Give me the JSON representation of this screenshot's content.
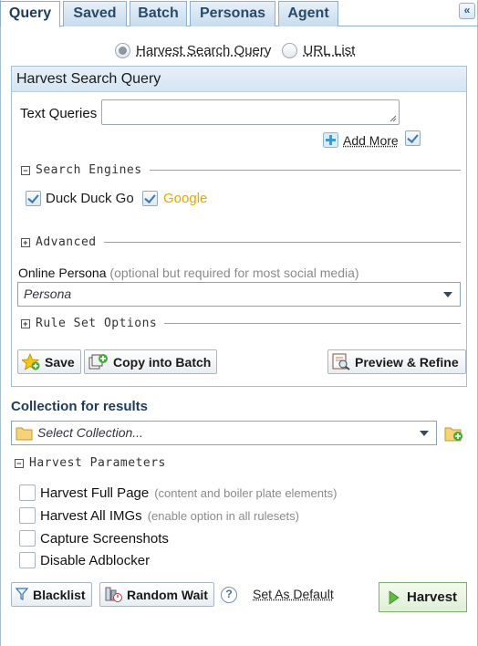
{
  "tabs": [
    {
      "label": "Query",
      "active": true
    },
    {
      "label": "Saved",
      "active": false
    },
    {
      "label": "Batch",
      "active": false
    },
    {
      "label": "Personas",
      "active": false
    },
    {
      "label": "Agent",
      "active": false
    }
  ],
  "collapse_glyph": "«",
  "mode": {
    "options": [
      {
        "label": "Harvest Search Query",
        "selected": true
      },
      {
        "label": "URL List",
        "selected": false
      }
    ]
  },
  "panel": {
    "title": "Harvest Search Query",
    "text_queries_label": "Text Queries",
    "text_queries_value": "",
    "text_queries_checked": true,
    "add_more_label": "Add More",
    "search_engines": {
      "title": "Search Engines",
      "engines": [
        {
          "label": "Duck Duck Go",
          "checked": true,
          "color": "#1a1a1a"
        },
        {
          "label": "Google",
          "checked": true,
          "color": "#e6a700"
        }
      ]
    },
    "advanced_title": "Advanced",
    "persona": {
      "label": "Online Persona",
      "hint": "(optional but required for most social media)",
      "selected": "Persona"
    },
    "rule_set_title": "Rule Set Options",
    "buttons": {
      "save": "Save",
      "copy_batch": "Copy into Batch",
      "preview": "Preview & Refine"
    }
  },
  "collection": {
    "label": "Collection for results",
    "selected": "Select Collection..."
  },
  "harvest_params": {
    "title": "Harvest Parameters",
    "options": [
      {
        "label": "Harvest Full Page",
        "hint": "(content and boiler plate elements)",
        "checked": false
      },
      {
        "label": "Harvest All IMGs",
        "hint": "(enable option in all rulesets)",
        "checked": false
      },
      {
        "label": "Capture Screenshots",
        "hint": "",
        "checked": false
      },
      {
        "label": "Disable Adblocker",
        "hint": "",
        "checked": false
      }
    ]
  },
  "footer": {
    "blacklist": "Blacklist",
    "random_wait": "Random Wait",
    "help_glyph": "?",
    "set_default": "Set As Default",
    "harvest": "Harvest"
  },
  "colors": {
    "tab_text": "#2a4a6a",
    "panel_border": "#a6bfd3",
    "heading": "#1c3c5c",
    "harvest_green": "#7db06a"
  }
}
